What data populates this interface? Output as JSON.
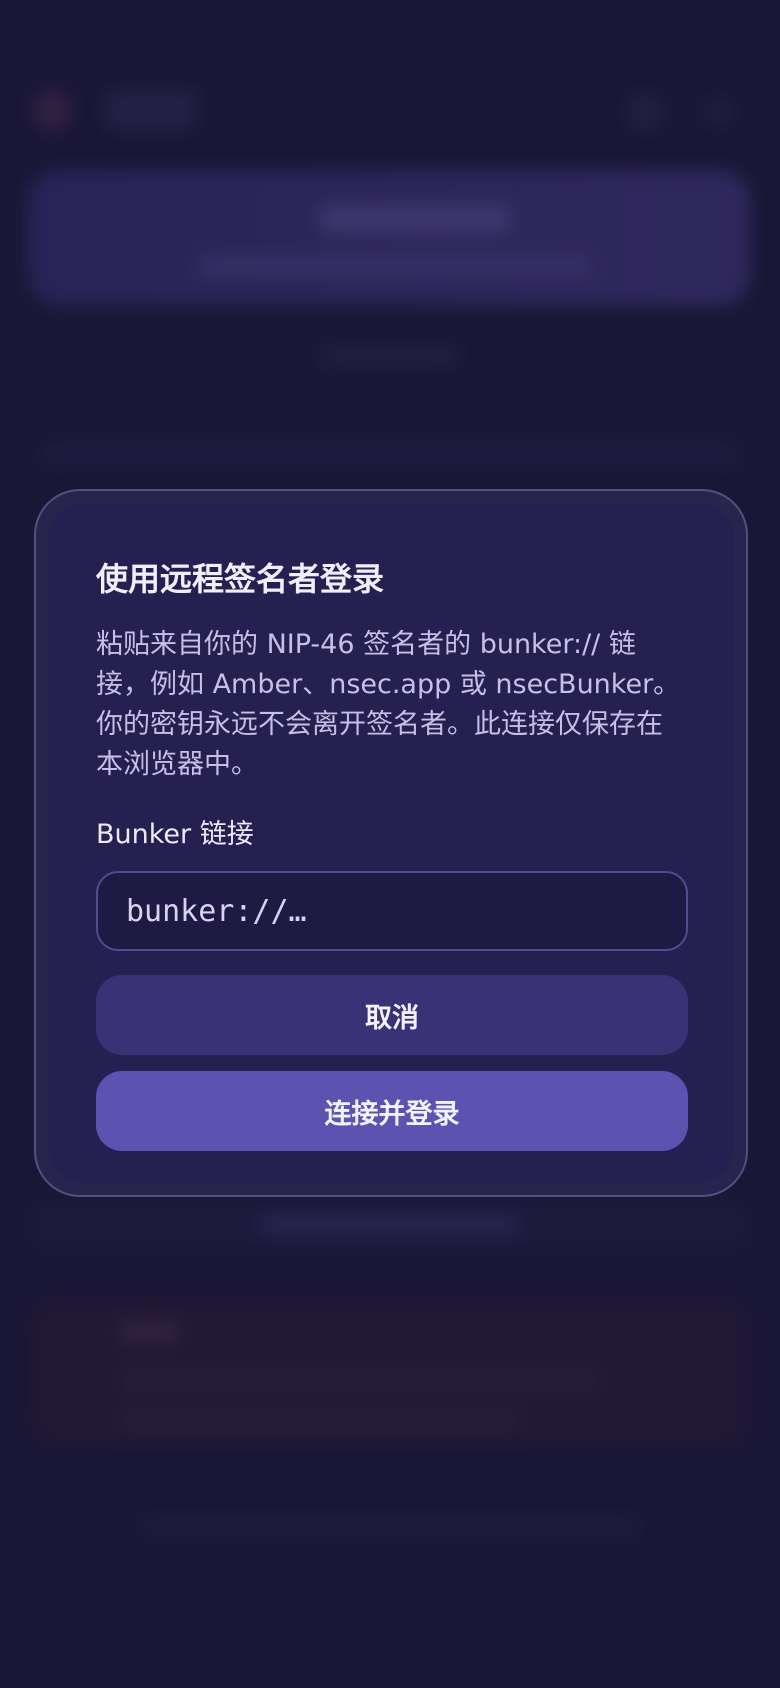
{
  "modal": {
    "title": "使用远程签名者登录",
    "description": "粘贴来自你的 NIP-46 签名者的 bunker:// 链接，例如 Amber、nsec.app 或 nsecBunker。你的密钥永远不会离开签名者。此连接仅保存在本浏览器中。",
    "field_label": "Bunker 链接",
    "input_value": "",
    "input_placeholder": "bunker://…",
    "cancel_label": "取消",
    "connect_label": "连接并登录"
  },
  "colors": {
    "background": "#1d1a3c",
    "modal_background": "#252050",
    "cancel_button": "#3a3277",
    "connect_button": "#5c52b0"
  }
}
